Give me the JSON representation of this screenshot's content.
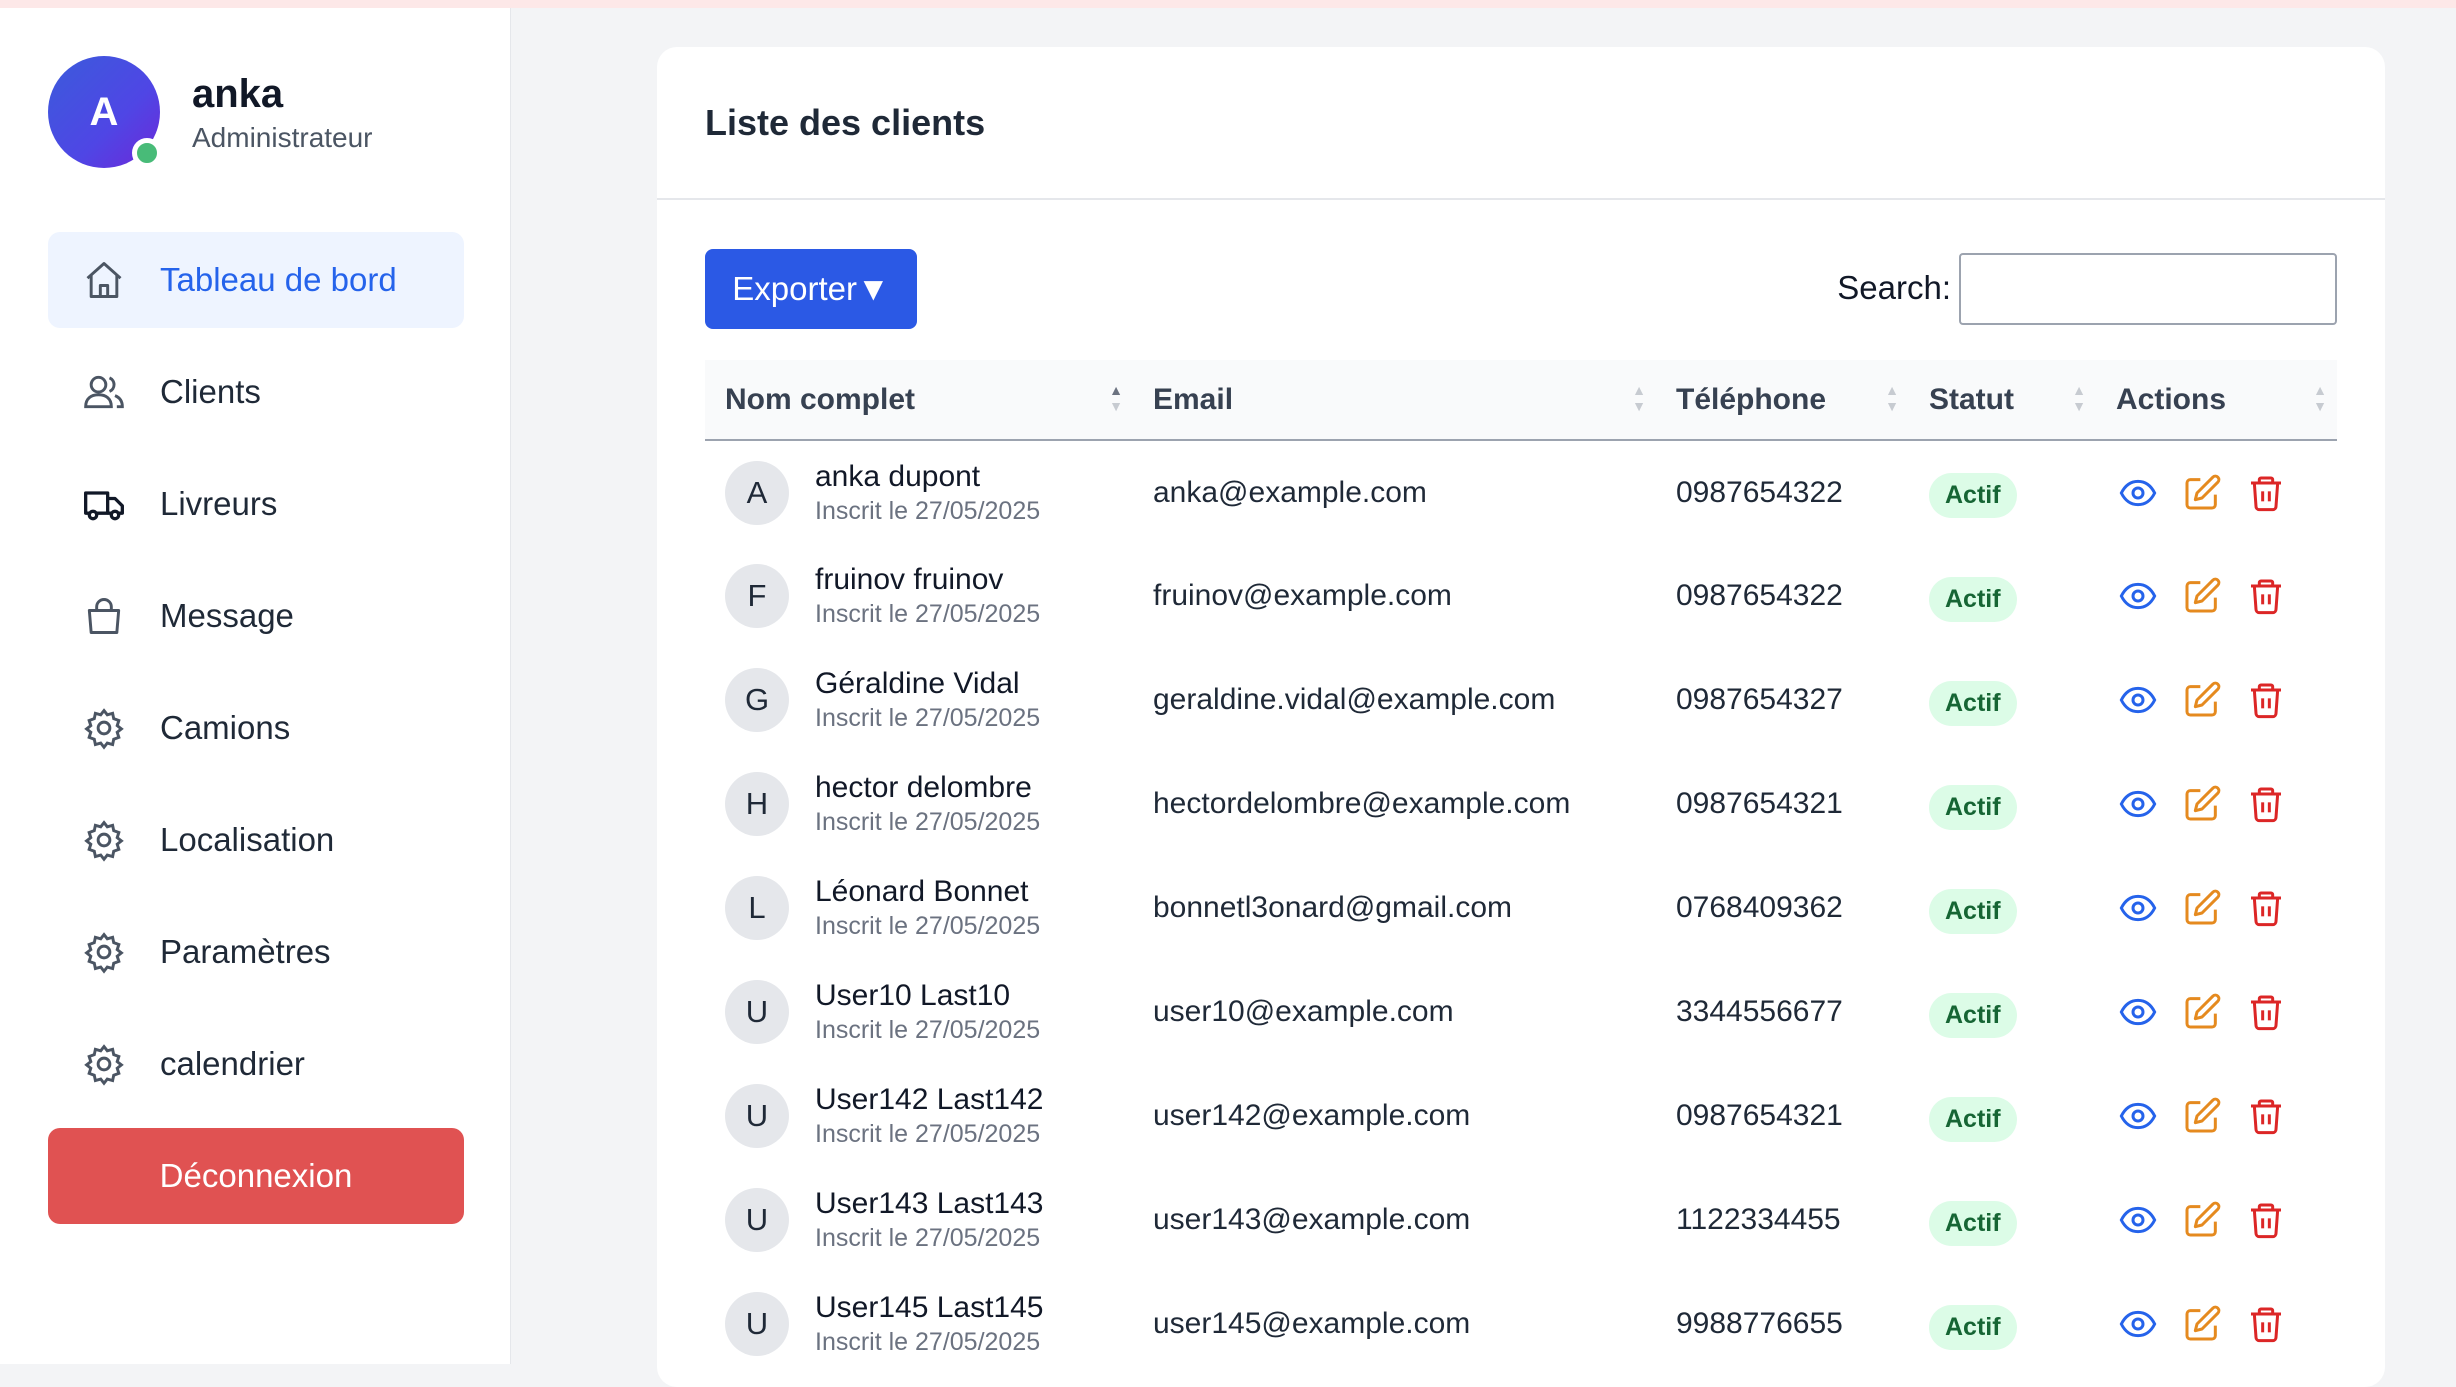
{
  "user": {
    "initial": "A",
    "name": "anka",
    "role": "Administrateur"
  },
  "nav": {
    "items": [
      {
        "label": "Tableau de bord",
        "icon": "home-icon"
      },
      {
        "label": "Clients",
        "icon": "users-icon"
      },
      {
        "label": "Livreurs",
        "icon": "truck-icon"
      },
      {
        "label": "Message",
        "icon": "bag-icon"
      },
      {
        "label": "Camions",
        "icon": "gear-icon"
      },
      {
        "label": "Localisation",
        "icon": "gear-icon"
      },
      {
        "label": "Paramètres",
        "icon": "gear-icon"
      },
      {
        "label": "calendrier",
        "icon": "gear-icon"
      }
    ],
    "logout_label": "Déconnexion"
  },
  "main": {
    "title": "Liste des clients",
    "export_label": "Exporter▼",
    "search_label": "Search:",
    "search_value": ""
  },
  "table": {
    "columns": [
      "Nom complet",
      "Email",
      "Téléphone",
      "Statut",
      "Actions"
    ],
    "rows": [
      {
        "initial": "A",
        "name": "anka dupont",
        "joined": "Inscrit le 27/05/2025",
        "email": "anka@example.com",
        "phone": "0987654322",
        "status": "Actif"
      },
      {
        "initial": "F",
        "name": "fruinov fruinov",
        "joined": "Inscrit le 27/05/2025",
        "email": "fruinov@example.com",
        "phone": "0987654322",
        "status": "Actif"
      },
      {
        "initial": "G",
        "name": "Géraldine Vidal",
        "joined": "Inscrit le 27/05/2025",
        "email": "geraldine.vidal@example.com",
        "phone": "0987654327",
        "status": "Actif"
      },
      {
        "initial": "H",
        "name": "hector delombre",
        "joined": "Inscrit le 27/05/2025",
        "email": "hectordelombre@example.com",
        "phone": "0987654321",
        "status": "Actif"
      },
      {
        "initial": "L",
        "name": "Léonard Bonnet",
        "joined": "Inscrit le 27/05/2025",
        "email": "bonnetl3onard@gmail.com",
        "phone": "0768409362",
        "status": "Actif"
      },
      {
        "initial": "U",
        "name": "User10 Last10",
        "joined": "Inscrit le 27/05/2025",
        "email": "user10@example.com",
        "phone": "3344556677",
        "status": "Actif"
      },
      {
        "initial": "U",
        "name": "User142 Last142",
        "joined": "Inscrit le 27/05/2025",
        "email": "user142@example.com",
        "phone": "0987654321",
        "status": "Actif"
      },
      {
        "initial": "U",
        "name": "User143 Last143",
        "joined": "Inscrit le 27/05/2025",
        "email": "user143@example.com",
        "phone": "1122334455",
        "status": "Actif"
      },
      {
        "initial": "U",
        "name": "User145 Last145",
        "joined": "Inscrit le 27/05/2025",
        "email": "user145@example.com",
        "phone": "9988776655",
        "status": "Actif"
      }
    ]
  },
  "colors": {
    "accent": "#2b59e5",
    "logout": "#e05252",
    "status_bg": "#dcfce7",
    "status_text": "#166534",
    "view_icon": "#2563eb",
    "edit_icon": "#e58a1f",
    "delete_icon": "#dc2626"
  }
}
